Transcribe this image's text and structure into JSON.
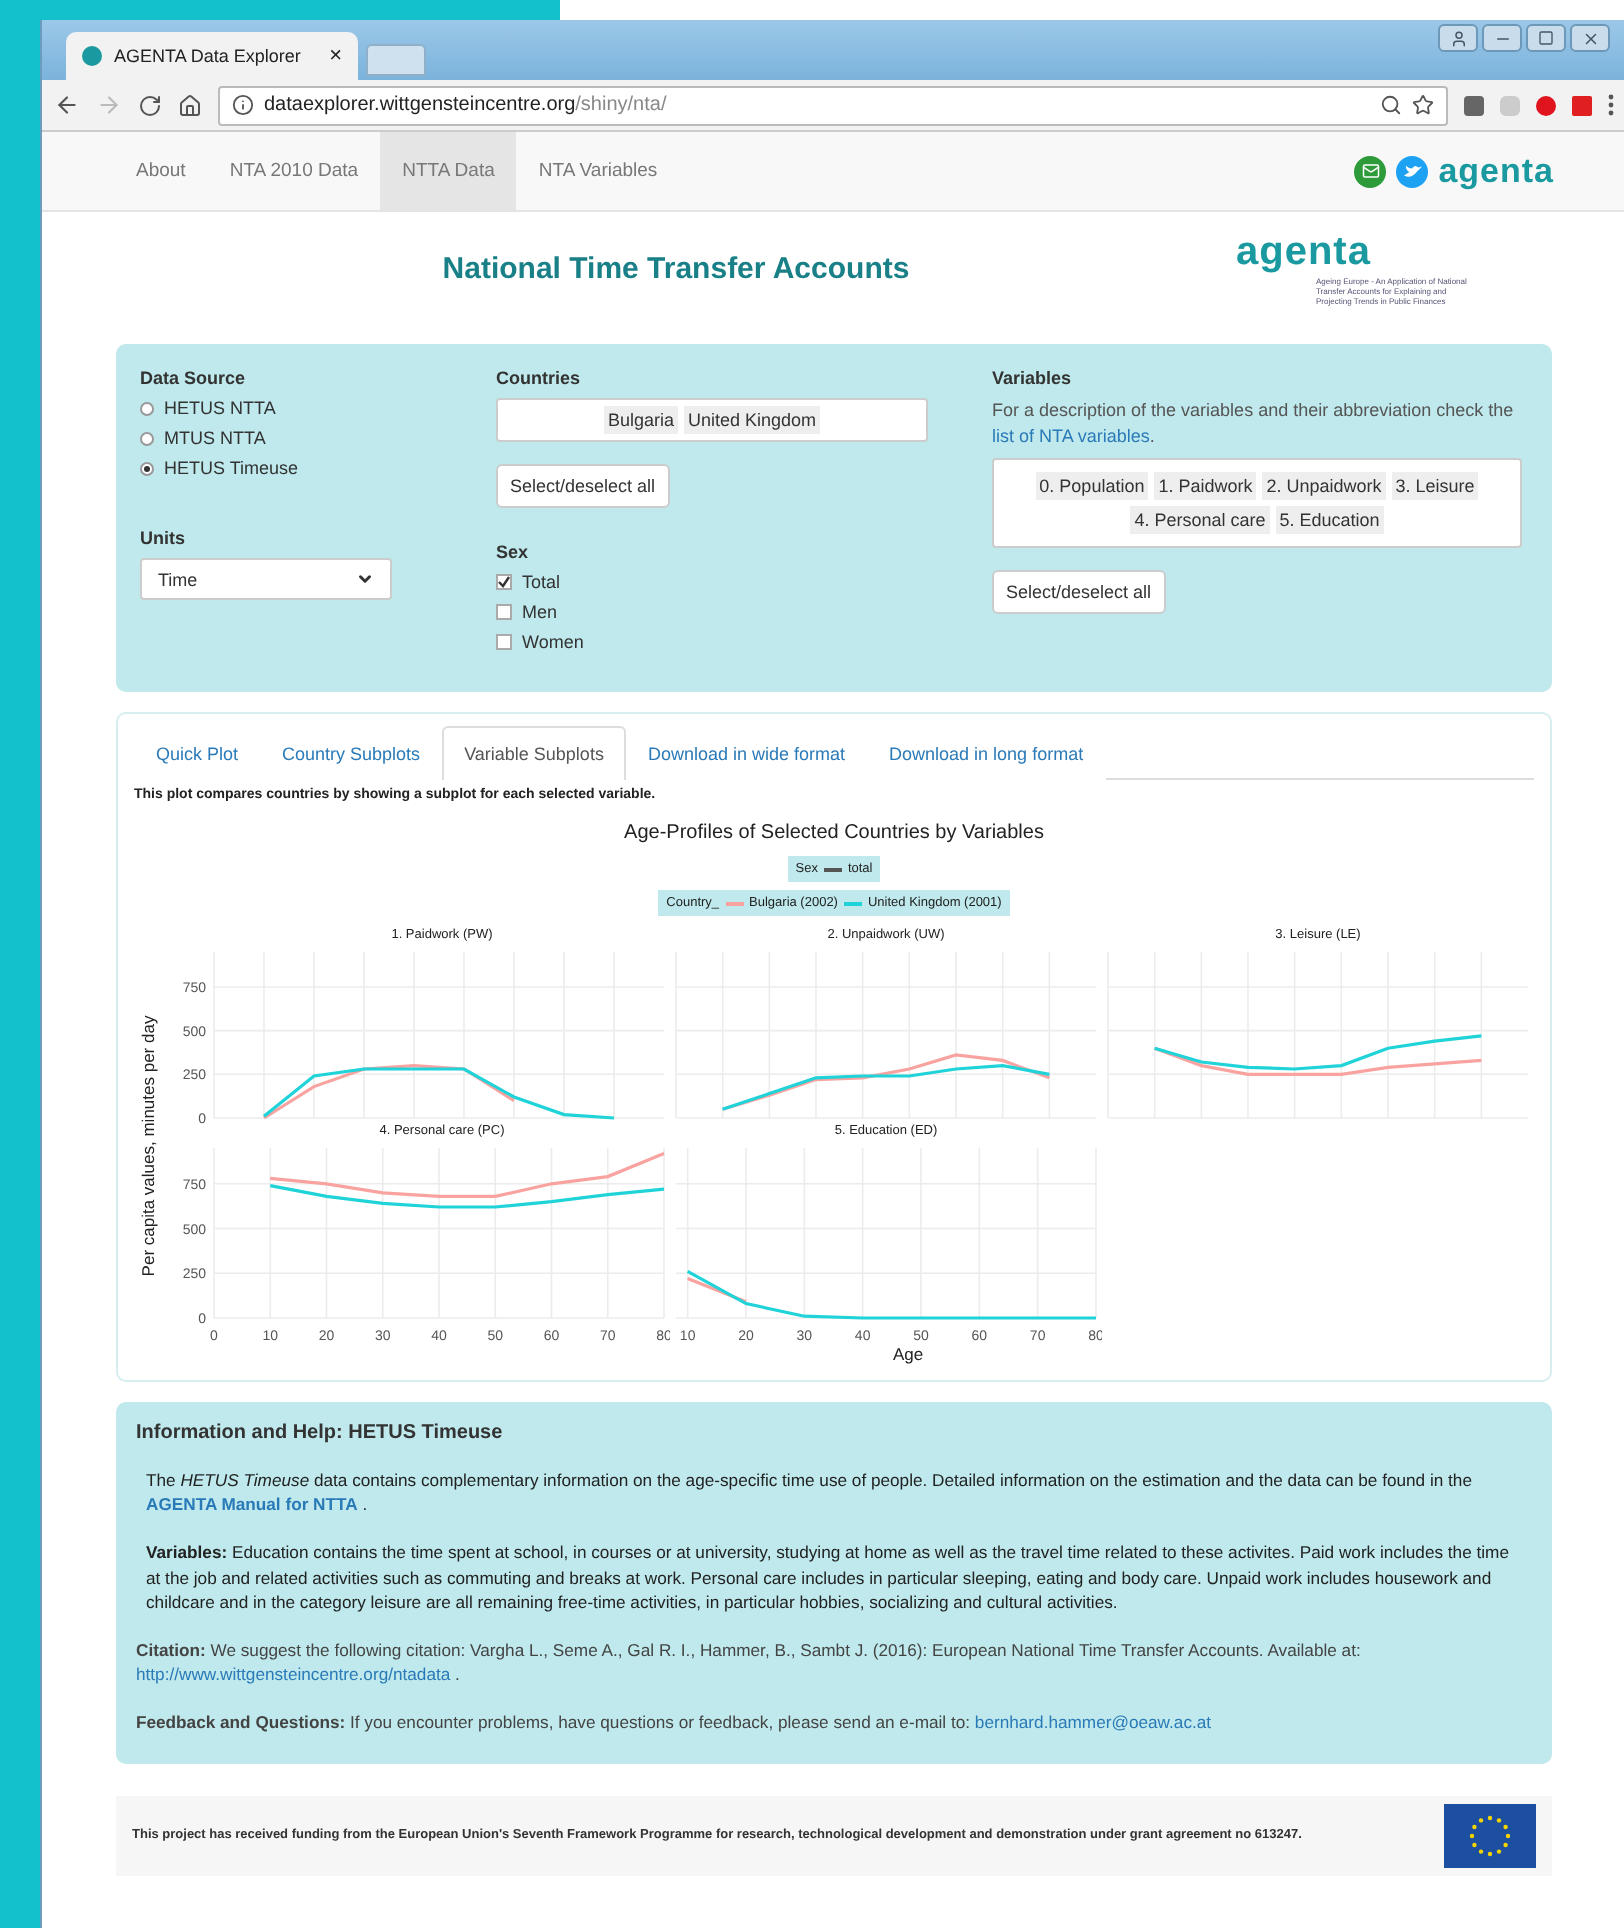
{
  "browser": {
    "tab_title": "AGENTA Data Explorer",
    "tab_close": "×",
    "url_host": "dataexplorer.wittgensteincentre.org",
    "url_path": "/shiny/nta/"
  },
  "navbar": {
    "items": [
      {
        "label": "About",
        "selected": false
      },
      {
        "label": "NTA 2010 Data",
        "selected": false
      },
      {
        "label": "NTTA Data",
        "selected": true
      },
      {
        "label": "NTA Variables",
        "selected": false
      }
    ],
    "logo": "agenta"
  },
  "header": {
    "title": "National Time Transfer Accounts",
    "logo": "agenta",
    "tagline": "Ageing Europe - An Application of National Transfer Accounts for Explaining and Projecting Trends in Public Finances"
  },
  "controls": {
    "data_source": {
      "label": "Data Source",
      "options": [
        {
          "label": "HETUS NTTA",
          "selected": false
        },
        {
          "label": "MTUS NTTA",
          "selected": false
        },
        {
          "label": "HETUS Timeuse",
          "selected": true
        }
      ]
    },
    "units": {
      "label": "Units",
      "value": "Time"
    },
    "countries": {
      "label": "Countries",
      "tags": [
        "Bulgaria",
        "United Kingdom"
      ],
      "button": "Select/deselect all"
    },
    "sex": {
      "label": "Sex",
      "options": [
        {
          "label": "Total",
          "checked": true
        },
        {
          "label": "Men",
          "checked": false
        },
        {
          "label": "Women",
          "checked": false
        }
      ]
    },
    "variables": {
      "label": "Variables",
      "description": "For a description of the variables and their abbreviation check the",
      "link": "list of NTA variables",
      "tail": ".",
      "tags": [
        "0. Population",
        "1. Paidwork",
        "2. Unpaidwork",
        "3. Leisure",
        "4. Personal care",
        "5. Education"
      ],
      "button": "Select/deselect all"
    }
  },
  "plot_card": {
    "tabs": [
      {
        "label": "Quick Plot",
        "selected": false
      },
      {
        "label": "Country Subplots",
        "selected": false
      },
      {
        "label": "Variable Subplots",
        "selected": true
      },
      {
        "label": "Download in wide format",
        "selected": false
      },
      {
        "label": "Download in long format",
        "selected": false
      }
    ],
    "description": "This plot compares countries by showing a subplot for each selected variable.",
    "chart_title": "Age-Profiles of Selected Countries by Variables",
    "legend": {
      "sex_title": "Sex",
      "sex_items": [
        "total"
      ],
      "country_title": "Country_",
      "country_items": [
        {
          "label": "Bulgaria (2002)",
          "color": "#f9a3a0"
        },
        {
          "label": "United Kingdom (2001)",
          "color": "#1fd3d9"
        }
      ]
    },
    "ylabel": "Per capita values, minutes per day",
    "xlabel": "Age",
    "panels": [
      {
        "chart_data": {
          "type": "line",
          "title": "1. Paidwork (PW)",
          "categories": [
            null,
            null,
            null,
            null,
            null,
            null,
            null,
            null
          ],
          "series": [
            {
              "color": "#f9a3a0",
              "values": [
                0,
                180,
                280,
                300,
                280,
                100,
                null,
                null
              ]
            },
            {
              "color": "#1fd3d9",
              "values": [
                10,
                240,
                280,
                280,
                280,
                120,
                20,
                0
              ]
            }
          ],
          "ylim": [
            0,
            950
          ],
          "yticks": [
            0,
            250,
            500,
            750
          ],
          "grid": true
        }
      },
      {
        "kind": "picture",
        "title": "2. Unpaidwork (UW)"
      },
      {
        "kind": "picture",
        "title": "3. Leisure (LE)"
      },
      {
        "chart_data": {
          "type": "line",
          "title": "4. Personal care (PC)",
          "x": [
            10,
            20,
            30,
            40,
            50,
            60,
            70,
            80
          ],
          "series": [
            {
              "color": "#f9a3a0",
              "values": [
                780,
                750,
                700,
                680,
                680,
                750,
                790,
                920
              ]
            },
            {
              "color": "#1fd3d9",
              "values": [
                740,
                680,
                640,
                620,
                620,
                650,
                690,
                720
              ]
            }
          ],
          "xlim": [
            0,
            80
          ],
          "ylim": [
            0,
            950
          ],
          "yticks": [
            0,
            250,
            500,
            750
          ],
          "xticks": [
            0,
            10,
            20,
            30,
            40,
            50,
            60,
            70,
            80
          ],
          "grid": true
        }
      },
      {
        "chart_data": {
          "type": "line",
          "title": "5. Education (ED)",
          "x": [
            10,
            20,
            30,
            40,
            50,
            60,
            70,
            80
          ],
          "series": [
            {
              "color": "#f9a3a0",
              "values": [
                220,
                90,
                null,
                null,
                null,
                null,
                null,
                null
              ]
            },
            {
              "color": "#1fd3d9",
              "values": [
                260,
                80,
                10,
                0,
                0,
                0,
                0,
                0
              ]
            }
          ],
          "xlim": [
            8,
            80
          ],
          "ylim": [
            0,
            950
          ],
          "xticks": [
            10,
            20,
            30,
            40,
            50,
            60,
            70,
            80
          ],
          "grid": true
        }
      }
    ]
  },
  "info": {
    "title": "Information and Help: HETUS Timeuse",
    "paragraphs": [
      {
        "kind": "body",
        "text": "The *HETUS Timeuse* data contains complementary information on the age-specific time use of people. Detailed information on the estimation and the data can be found in the",
        "link": "AGENTA Manual for NTTA",
        "tail": " ."
      },
      {
        "kind": "body",
        "text": "**Variables:** Education contains the time spent at school, in courses or at university, studying at home as well as the travel time related to these activites. Paid work includes the time at the job and related activities such as commuting and breaks at work. Personal care includes in particular sleeping, eating and body care. Unpaid work includes housework and childcare and in the category leisure are all remaining free-time activities, in particular hobbies, socializing and cultural activities."
      },
      {
        "kind": "note",
        "text": "**Citation:** We suggest the following citation: Vargha L., Seme A., Gal R. I., Hammer, B., Sambt J. (2016): European National Time Transfer Accounts. Available at:",
        "link": "http://www.wittgensteincentre.org/ntadata",
        "tail": " ."
      },
      {
        "kind": "note",
        "text": "**Feedback and Questions:** If you encounter problems, have questions or feedback, please send an e-mail to:",
        "link": "bernhard.hammer@oeaw.ac.at"
      }
    ]
  },
  "footer": {
    "text": "This project has received funding from the European Union's Seventh Framework Programme for research, technological development and demonstration under grant agreement no 613247."
  }
}
